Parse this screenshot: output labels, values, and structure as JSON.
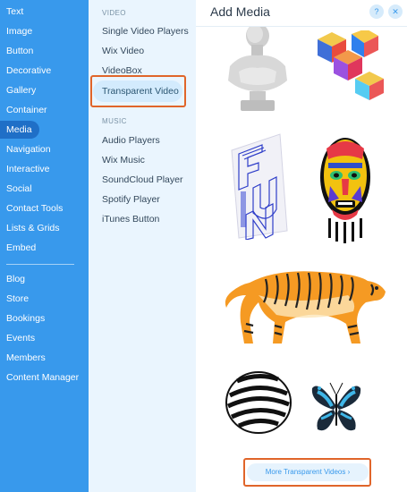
{
  "sidebar": {
    "items": [
      {
        "label": "Text"
      },
      {
        "label": "Image"
      },
      {
        "label": "Button"
      },
      {
        "label": "Decorative"
      },
      {
        "label": "Gallery"
      },
      {
        "label": "Container"
      },
      {
        "label": "Media",
        "active": true
      },
      {
        "label": "Navigation"
      },
      {
        "label": "Interactive"
      },
      {
        "label": "Social"
      },
      {
        "label": "Contact Tools"
      },
      {
        "label": "Lists & Grids"
      },
      {
        "label": "Embed"
      },
      {
        "label": "Blog"
      },
      {
        "label": "Store"
      },
      {
        "label": "Bookings"
      },
      {
        "label": "Events"
      },
      {
        "label": "Members"
      },
      {
        "label": "Content Manager"
      }
    ]
  },
  "subpanel": {
    "video_header": "VIDEO",
    "video_items": [
      "Single Video Players",
      "Wix Video",
      "VideoBox",
      "Transparent Video"
    ],
    "selected": "Transparent Video",
    "music_header": "MUSIC",
    "music_items": [
      "Audio Players",
      "Wix Music",
      "SoundCloud Player",
      "Spotify Player",
      "iTunes Button"
    ]
  },
  "content": {
    "title": "Add Media",
    "help_label": "?",
    "close_label": "✕",
    "more_button_label": "More Transparent Videos ›"
  },
  "colors": {
    "sidebar_bg": "#3899ec",
    "sidebar_active": "#1f6fc7",
    "subpanel_bg": "#eaf5fe",
    "highlight_orange": "#e0652a"
  }
}
